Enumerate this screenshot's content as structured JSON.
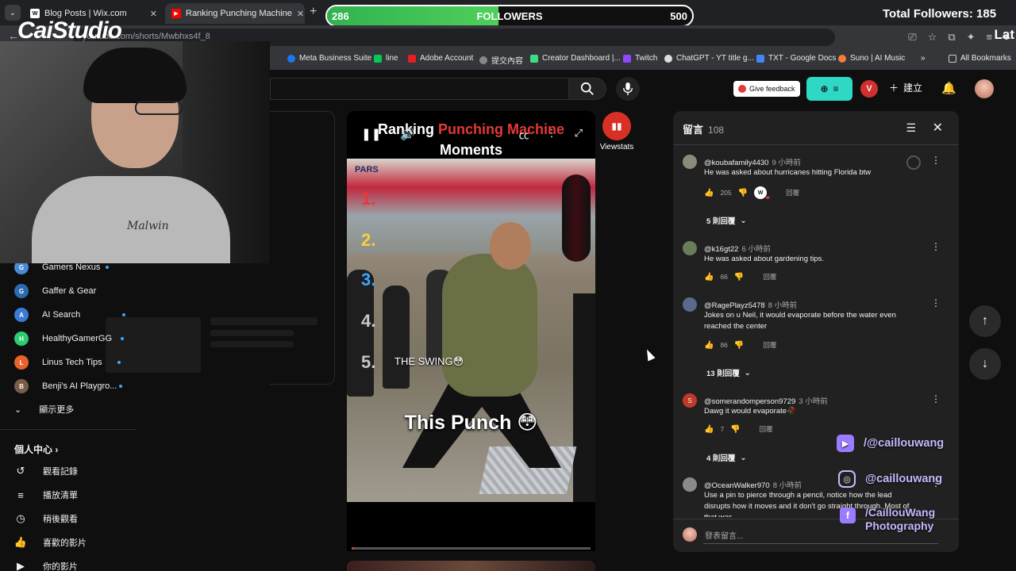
{
  "browser": {
    "tab_menu_icon": "chevron-down",
    "tabs": [
      {
        "title": "Blog Posts | Wix.com",
        "favicon": "Wix"
      },
      {
        "title": "Ranking Punching Machine",
        "favicon": "yt"
      }
    ],
    "address_text": "youtube.com/shorts/Mwbhxs4f_8",
    "bookmarks": [
      "Meta Business Suite",
      "line",
      "Adobe Account",
      "提交內容",
      "Creator Dashboard |...",
      "Twitch",
      "ChatGPT - YT title g...",
      "TXT - Google Docs",
      "Suno | AI Music"
    ],
    "all_bookmarks": "All Bookmarks",
    "bookmarks_more": "»"
  },
  "overlay": {
    "followers_min": "286",
    "followers_label": "FOLLOWERS",
    "followers_max": "500",
    "followers_progress": 0.47,
    "total_followers": "Total Followers: 185",
    "lat_text": "Lat",
    "logo": "CaiStudio",
    "shirt_text": "Malwin",
    "social": {
      "youtube": "/@caillouwang",
      "instagram": "@caillouwang",
      "facebook_line1": "/CaillouWang",
      "facebook_line2": "Photography"
    }
  },
  "header": {
    "feedback": "Give feedback",
    "create": "建立",
    "viewstats": "Viewstats"
  },
  "guide": {
    "subscriptions": [
      {
        "name": "Gamers Nexus",
        "color": "#4a8ad4",
        "glyph": "G"
      },
      {
        "name": "Gaffer & Gear",
        "color": "#2b6cb0",
        "glyph": "G"
      },
      {
        "name": "AI Search",
        "color": "#3a7bd5",
        "glyph": "A"
      },
      {
        "name": "HealthyGamerGG",
        "color": "#2ecc71",
        "glyph": "H"
      },
      {
        "name": "Linus Tech Tips",
        "color": "#e8632b",
        "glyph": "L"
      },
      {
        "name": "Benji's AI Playgro...",
        "color": "#7a5c48",
        "glyph": "B"
      }
    ],
    "show_more": "顯示更多",
    "you_heading": "個人中心",
    "you_items": [
      {
        "label": "觀看記錄",
        "icon": "history-icon",
        "glyph": "↺"
      },
      {
        "label": "播放清單",
        "icon": "playlist-icon",
        "glyph": "≡"
      },
      {
        "label": "稍後觀看",
        "icon": "clock-icon",
        "glyph": "◷"
      },
      {
        "label": "喜歡的影片",
        "icon": "thumbs-up-icon",
        "glyph": "👍"
      },
      {
        "label": "你的影片",
        "icon": "video-icon",
        "glyph": "▶"
      }
    ]
  },
  "player": {
    "title_part1": "Ranking",
    "title_part2": "Punching Machine",
    "title_line2": "Moments",
    "rank_numbers": [
      "1.",
      "2.",
      "3.",
      "4.",
      "5."
    ],
    "swing_label": "THE SWING😳",
    "caption": "This Punch 😳",
    "progress": 0.01,
    "shop_sign": "PARS"
  },
  "comments": {
    "heading": "留言",
    "count": "108",
    "input_placeholder": "發表留言...",
    "reply_label": "回覆",
    "items": [
      {
        "author": "@koubafamily4430",
        "time": "9 小時前",
        "text": "He was asked about hurricanes hitting Florida btw",
        "likes": "205",
        "avatar": "#8d8a7a",
        "creator_heart": "W"
      },
      {
        "author": "@k16gt22",
        "time": "6 小時前",
        "text": "He was asked about gardening tips.",
        "likes": "66",
        "avatar": "#6a7d5a"
      },
      {
        "author": "@RagePlayz5478",
        "time": "8 小時前",
        "text": "Jokes on u Neil, it would evaporate before the water even reached the center",
        "likes": "86",
        "avatar": "#5a6a8a"
      },
      {
        "author": "@somerandomperson9729",
        "time": "3 小時前",
        "text": "Dawg it would evaporate🥀",
        "likes": "7",
        "avatar": "#c0392b",
        "avatar_letter": "S"
      },
      {
        "author": "@OceanWalker970",
        "time": "8 小時前",
        "text": "Use a pin to pierce through a pencil, notice how the lead disrupts how it moves and it don't go straight through. Most of that was",
        "likes": "",
        "avatar": "#8a8a8a"
      }
    ],
    "reply_toggles": [
      "5 則回覆",
      "13 則回覆",
      "4 則回覆"
    ]
  }
}
